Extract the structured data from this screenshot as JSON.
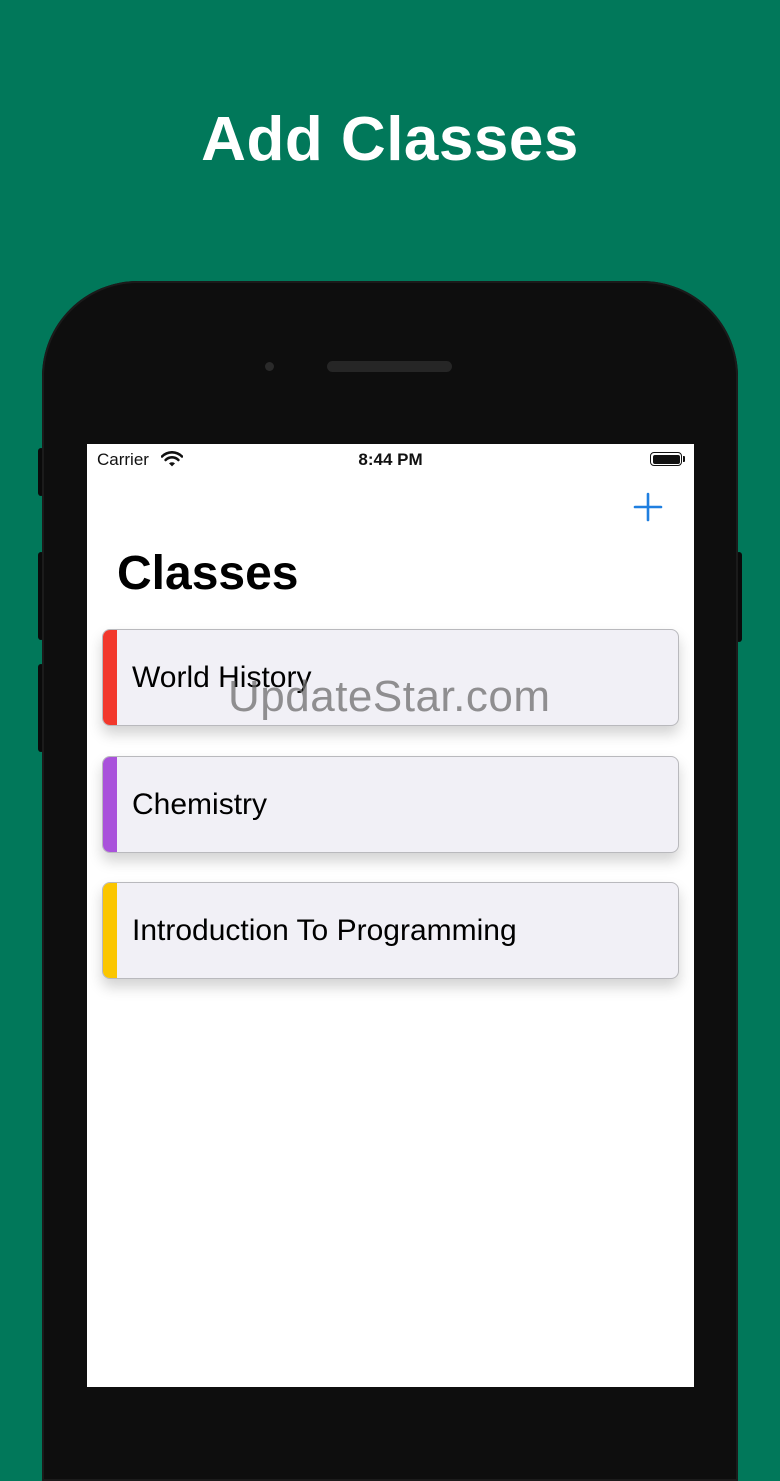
{
  "promo": {
    "headline": "Add Classes"
  },
  "status_bar": {
    "carrier": "Carrier",
    "time": "8:44 PM"
  },
  "nav": {
    "title": "Classes",
    "add_icon": "plus-icon"
  },
  "classes": [
    {
      "name": "World History",
      "color": "#f2382c"
    },
    {
      "name": "Chemistry",
      "color": "#a952db"
    },
    {
      "name": "Introduction To Programming",
      "color": "#fbc600"
    }
  ],
  "watermark": "UpdateStar.com",
  "colors": {
    "background": "#01785a",
    "accent_blue": "#1f7fe0"
  }
}
